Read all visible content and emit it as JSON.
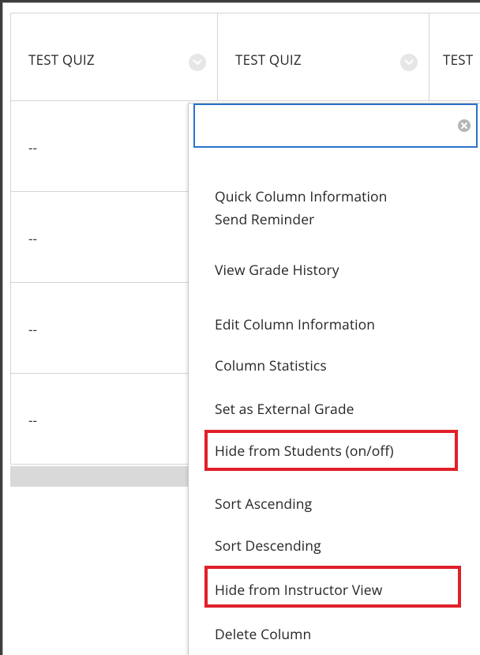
{
  "grid": {
    "columns": [
      {
        "header": "TEST QUIZ"
      },
      {
        "header": "TEST QUIZ"
      },
      {
        "header": "TEST"
      }
    ],
    "rows": [
      {
        "value": "--"
      },
      {
        "value": "--"
      },
      {
        "value": "--"
      },
      {
        "value": "--"
      }
    ]
  },
  "menu": {
    "search": {
      "value": "",
      "placeholder": ""
    },
    "items": [
      {
        "label": "Quick Column Information"
      },
      {
        "label": "Send Reminder"
      },
      {
        "label": "View Grade History"
      },
      {
        "label": "Edit Column Information"
      },
      {
        "label": "Column Statistics"
      },
      {
        "label": "Set as External Grade"
      },
      {
        "label": "Hide from Students (on/off)",
        "highlighted": true
      },
      {
        "label": "Sort Ascending"
      },
      {
        "label": "Sort Descending"
      },
      {
        "label": "Hide from Instructor View",
        "highlighted": true
      },
      {
        "label": "Delete Column"
      }
    ]
  },
  "colors": {
    "highlight": "#e0202a",
    "search_border": "#2b74c8",
    "divider": "#d4d4d4",
    "footer_bar": "#d9d9d9"
  },
  "icons": {
    "column_menu": "chevron-down-circle-icon",
    "clear_search": "clear-circle-icon"
  }
}
